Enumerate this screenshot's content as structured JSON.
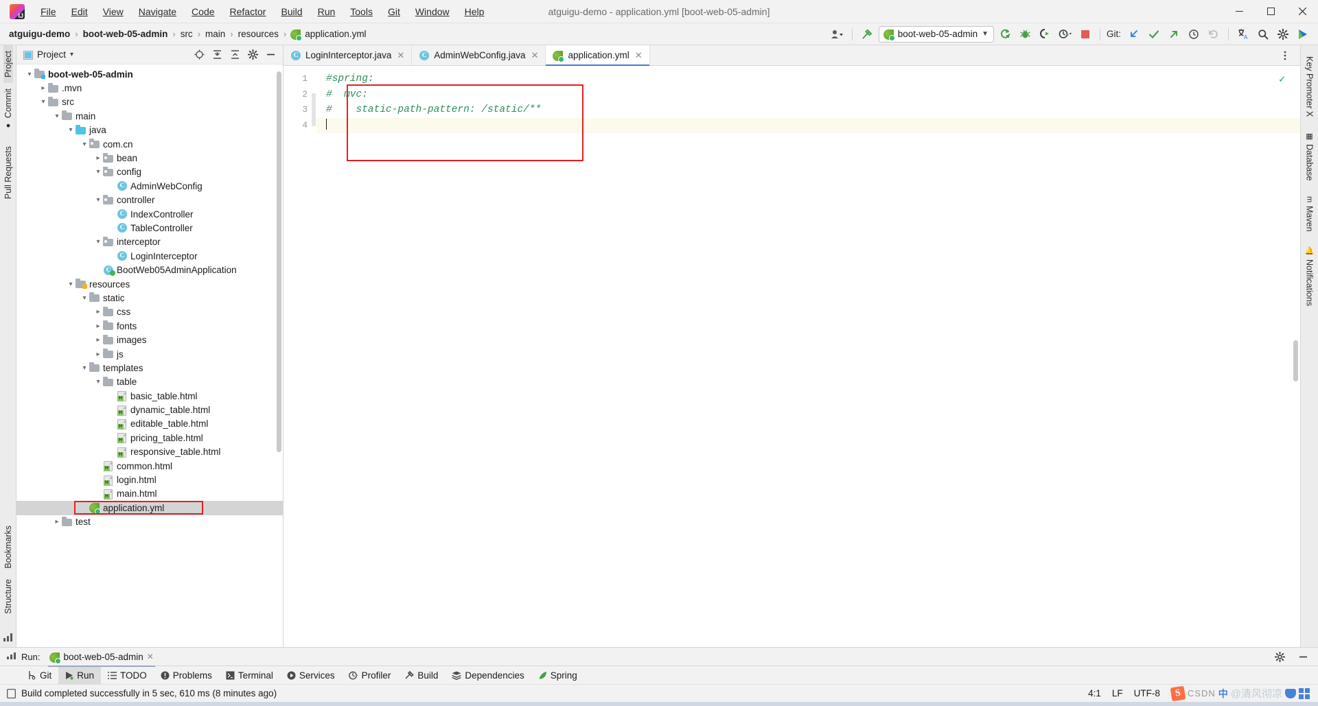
{
  "window": {
    "title": "atguigu-demo - application.yml [boot-web-05-admin]",
    "minimize": "—",
    "maximize": "❐",
    "close": "✕"
  },
  "menubar": {
    "items": [
      {
        "label": "File",
        "mnemonic": "F"
      },
      {
        "label": "Edit",
        "mnemonic": "E"
      },
      {
        "label": "View",
        "mnemonic": "V"
      },
      {
        "label": "Navigate",
        "mnemonic": "N"
      },
      {
        "label": "Code",
        "mnemonic": "C"
      },
      {
        "label": "Refactor",
        "mnemonic": "R"
      },
      {
        "label": "Build",
        "mnemonic": "B"
      },
      {
        "label": "Run",
        "mnemonic": "u"
      },
      {
        "label": "Tools",
        "mnemonic": "T"
      },
      {
        "label": "Git",
        "mnemonic": "G"
      },
      {
        "label": "Window",
        "mnemonic": "W"
      },
      {
        "label": "Help",
        "mnemonic": "H"
      }
    ]
  },
  "navbar": {
    "breadcrumbs": [
      {
        "label": "atguigu-demo",
        "bold": true,
        "icon": null
      },
      {
        "label": "boot-web-05-admin",
        "bold": true,
        "icon": null
      },
      {
        "label": "src",
        "bold": false,
        "icon": null
      },
      {
        "label": "main",
        "bold": false,
        "icon": null
      },
      {
        "label": "resources",
        "bold": false,
        "icon": null
      },
      {
        "label": "application.yml",
        "bold": false,
        "icon": "spring-file-icon"
      }
    ],
    "separator": "›",
    "run_configuration": "boot-web-05-admin",
    "git_label": "Git:",
    "icons": [
      "user-dropdown-icon",
      "build-hammer-icon",
      "run-icon",
      "debug-icon",
      "run-with-coverage-icon",
      "profiler-icon",
      "stop-icon",
      "git-update-icon",
      "git-commit-icon",
      "git-push-icon",
      "history-icon",
      "rollback-icon",
      "translate-icon",
      "search-icon",
      "settings-gear-icon",
      "ide-eye-icon"
    ]
  },
  "left_strip": {
    "top": [
      "Project",
      "Commit",
      "Pull Requests"
    ],
    "bottom": [
      "Bookmarks",
      "Structure"
    ],
    "active": "Project"
  },
  "right_strip": {
    "items": [
      "Key Promoter X",
      "Database",
      "Maven",
      "Notifications"
    ]
  },
  "project_panel": {
    "title": "Project",
    "dropdown_caret": "▾",
    "header_icons": [
      "locate-icon",
      "expand-all-icon",
      "collapse-all-icon",
      "settings-gear-icon",
      "hide-icon"
    ],
    "tree": [
      {
        "label": "boot-web-05-admin",
        "depth": 0,
        "twist": "⌄",
        "icon": "folder-module",
        "bold": true
      },
      {
        "label": ".mvn",
        "depth": 1,
        "twist": "›",
        "icon": "folder-plain",
        "bold": false
      },
      {
        "label": "src",
        "depth": 1,
        "twist": "⌄",
        "icon": "folder-plain",
        "bold": false
      },
      {
        "label": "main",
        "depth": 2,
        "twist": "⌄",
        "icon": "folder-plain",
        "bold": false
      },
      {
        "label": "java",
        "depth": 3,
        "twist": "⌄",
        "icon": "folder-source",
        "bold": false
      },
      {
        "label": "com.cn",
        "depth": 4,
        "twist": "⌄",
        "icon": "folder-package",
        "bold": false
      },
      {
        "label": "bean",
        "depth": 5,
        "twist": "›",
        "icon": "folder-package",
        "bold": false
      },
      {
        "label": "config",
        "depth": 5,
        "twist": "⌄",
        "icon": "folder-package",
        "bold": false
      },
      {
        "label": "AdminWebConfig",
        "depth": 6,
        "twist": "",
        "icon": "java-class",
        "bold": false
      },
      {
        "label": "controller",
        "depth": 5,
        "twist": "⌄",
        "icon": "folder-package",
        "bold": false
      },
      {
        "label": "IndexController",
        "depth": 6,
        "twist": "",
        "icon": "java-class",
        "bold": false
      },
      {
        "label": "TableController",
        "depth": 6,
        "twist": "",
        "icon": "java-class",
        "bold": false
      },
      {
        "label": "interceptor",
        "depth": 5,
        "twist": "⌄",
        "icon": "folder-package",
        "bold": false
      },
      {
        "label": "LoginInterceptor",
        "depth": 6,
        "twist": "",
        "icon": "java-class",
        "bold": false
      },
      {
        "label": "BootWeb05AdminApplication",
        "depth": 5,
        "twist": "",
        "icon": "spring-boot-class",
        "bold": false
      },
      {
        "label": "resources",
        "depth": 3,
        "twist": "⌄",
        "icon": "folder-resources",
        "bold": false
      },
      {
        "label": "static",
        "depth": 4,
        "twist": "⌄",
        "icon": "folder-plain",
        "bold": false
      },
      {
        "label": "css",
        "depth": 5,
        "twist": "›",
        "icon": "folder-plain",
        "bold": false
      },
      {
        "label": "fonts",
        "depth": 5,
        "twist": "›",
        "icon": "folder-plain",
        "bold": false
      },
      {
        "label": "images",
        "depth": 5,
        "twist": "›",
        "icon": "folder-plain",
        "bold": false
      },
      {
        "label": "js",
        "depth": 5,
        "twist": "›",
        "icon": "folder-plain",
        "bold": false
      },
      {
        "label": "templates",
        "depth": 4,
        "twist": "⌄",
        "icon": "folder-plain",
        "bold": false
      },
      {
        "label": "table",
        "depth": 5,
        "twist": "⌄",
        "icon": "folder-plain",
        "bold": false
      },
      {
        "label": "basic_table.html",
        "depth": 6,
        "twist": "",
        "icon": "html-file",
        "bold": false
      },
      {
        "label": "dynamic_table.html",
        "depth": 6,
        "twist": "",
        "icon": "html-file",
        "bold": false
      },
      {
        "label": "editable_table.html",
        "depth": 6,
        "twist": "",
        "icon": "html-file",
        "bold": false
      },
      {
        "label": "pricing_table.html",
        "depth": 6,
        "twist": "",
        "icon": "html-file",
        "bold": false
      },
      {
        "label": "responsive_table.html",
        "depth": 6,
        "twist": "",
        "icon": "html-file",
        "bold": false
      },
      {
        "label": "common.html",
        "depth": 5,
        "twist": "",
        "icon": "html-file",
        "bold": false
      },
      {
        "label": "login.html",
        "depth": 5,
        "twist": "",
        "icon": "html-file",
        "bold": false
      },
      {
        "label": "main.html",
        "depth": 5,
        "twist": "",
        "icon": "html-file",
        "bold": false
      },
      {
        "label": "application.yml",
        "depth": 4,
        "twist": "",
        "icon": "spring-file-icon",
        "bold": false,
        "selected": true,
        "highlighted": true
      },
      {
        "label": "test",
        "depth": 2,
        "twist": "›",
        "icon": "folder-plain",
        "bold": false
      }
    ]
  },
  "editor": {
    "tabs": [
      {
        "label": "LoginInterceptor.java",
        "icon": "java-class",
        "active": false,
        "close": "✕"
      },
      {
        "label": "AdminWebConfig.java",
        "icon": "java-class",
        "active": false,
        "close": "✕"
      },
      {
        "label": "application.yml",
        "icon": "spring-file-icon",
        "active": true,
        "close": "✕"
      }
    ],
    "more_icon": "more-vertical-icon",
    "line_numbers": [
      "1",
      "2",
      "3",
      "4"
    ],
    "lines": [
      {
        "text": "#spring:",
        "style": "comment"
      },
      {
        "text": "#  mvc:",
        "style": "comment"
      },
      {
        "text": "#    static-path-pattern: /static/**",
        "style": "comment"
      },
      {
        "text": "",
        "style": "caret"
      }
    ],
    "inspection_status": "✓",
    "highlight_color": "#e02020"
  },
  "run_toolwindow": {
    "label": "Run:",
    "tab": "boot-web-05-admin",
    "close": "✕",
    "right_icons": [
      "settings-gear-icon",
      "hide-icon"
    ]
  },
  "bottom_tools": [
    {
      "label": "Git",
      "icon": "git-branch-icon",
      "active": false
    },
    {
      "label": "Run",
      "icon": "run-icon",
      "active": true
    },
    {
      "label": "TODO",
      "icon": "todo-list-icon",
      "active": false
    },
    {
      "label": "Problems",
      "icon": "problems-icon",
      "active": false
    },
    {
      "label": "Terminal",
      "icon": "terminal-icon",
      "active": false
    },
    {
      "label": "Services",
      "icon": "services-icon",
      "active": false
    },
    {
      "label": "Profiler",
      "icon": "profiler-icon",
      "active": false
    },
    {
      "label": "Build",
      "icon": "build-hammer-icon",
      "active": false
    },
    {
      "label": "Dependencies",
      "icon": "dependencies-icon",
      "active": false
    },
    {
      "label": "Spring",
      "icon": "spring-leaf-icon",
      "active": false
    }
  ],
  "statusbar": {
    "message": "Build completed successfully in 5 sec, 610 ms (8 minutes ago)",
    "message_icon": "event-log-icon",
    "caret_position": "4:1",
    "line_separator": "LF",
    "encoding": "UTF-8",
    "watermark": {
      "brand": "CSDN",
      "author": "@清风彻凉",
      "ime": "中",
      "logo_letter": "S"
    }
  }
}
